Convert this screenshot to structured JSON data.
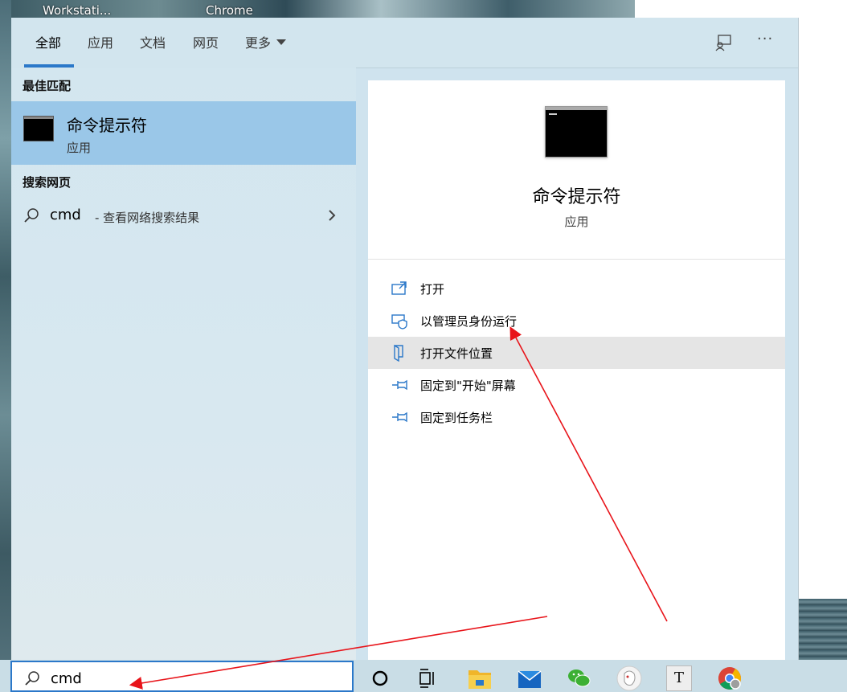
{
  "desktop": {
    "labels": [
      "Workstati...",
      "Chrome"
    ]
  },
  "tabs": [
    {
      "label": "全部",
      "active": true
    },
    {
      "label": "应用"
    },
    {
      "label": "文档"
    },
    {
      "label": "网页"
    },
    {
      "label": "更多"
    }
  ],
  "toolbar": {
    "feedback_icon": "feedback-icon",
    "more_icon": "ellipsis-icon",
    "more_text": "···"
  },
  "left": {
    "best_match_title": "最佳匹配",
    "best_match": {
      "name": "命令提示符",
      "type": "应用"
    },
    "web_title": "搜索网页",
    "web_result": {
      "query": "cmd",
      "suffix": "- 查看网络搜索结果"
    }
  },
  "right": {
    "title": "命令提示符",
    "type": "应用",
    "actions": [
      {
        "label": "打开",
        "icon": "open-icon"
      },
      {
        "label": "以管理员身份运行",
        "icon": "admin-shield-icon"
      },
      {
        "label": "打开文件位置",
        "icon": "file-location-icon",
        "highlighted": true
      },
      {
        "label": "固定到\"开始\"屏幕",
        "icon": "pin-start-icon"
      },
      {
        "label": "固定到任务栏",
        "icon": "pin-taskbar-icon"
      }
    ]
  },
  "search": {
    "value": "cmd"
  },
  "taskbar": {
    "icons": [
      "cortana-icon",
      "task-view-icon",
      "file-explorer-icon",
      "mail-icon",
      "wechat-icon",
      "app-icon",
      "typora-icon",
      "chrome-icon"
    ],
    "typora_letter": "T"
  },
  "colors": {
    "accent": "#2b78c9",
    "selection": "#9ac7e8",
    "hover": "#e5e5e5",
    "annotation": "#e8141a"
  }
}
